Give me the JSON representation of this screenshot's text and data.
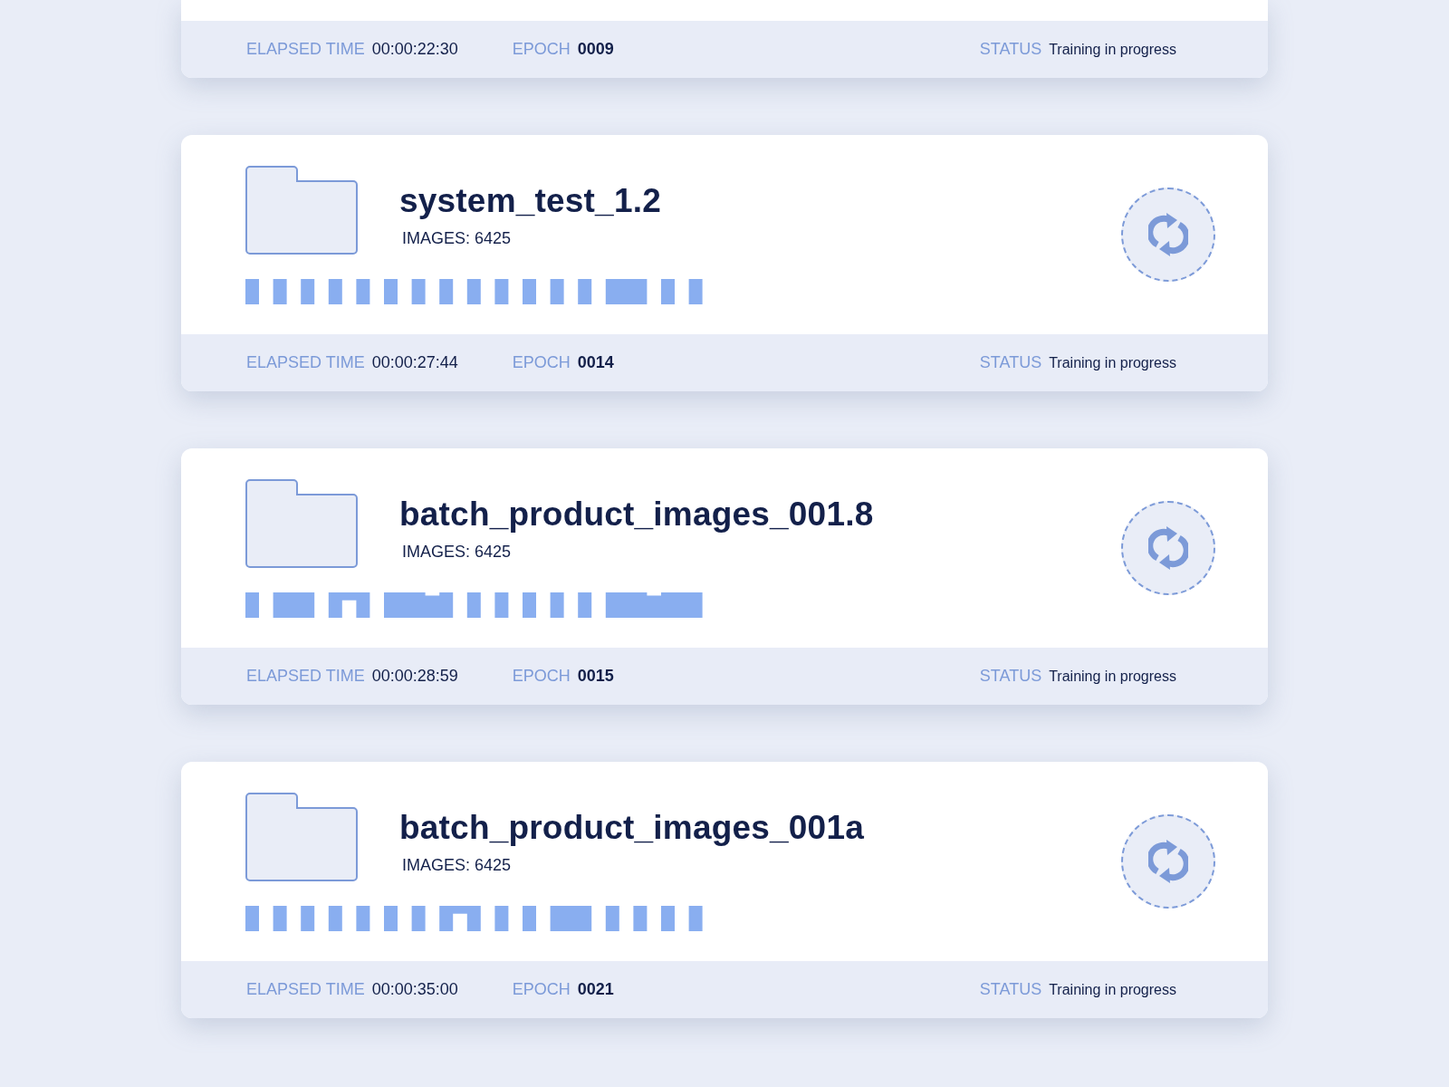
{
  "cards": [
    {
      "elapsed_label": "ELAPSED TIME",
      "elapsed": "00:00:22:30",
      "epoch_label": "EPOCH",
      "epoch": "0009",
      "status_label": "STATUS",
      "status": "Training in progress"
    },
    {
      "name": "system_test_1.2",
      "images": "IMAGES: 6425",
      "segments": [
        {
          "kind": "tick"
        },
        {
          "kind": "tick"
        },
        {
          "kind": "tick"
        },
        {
          "kind": "tick"
        },
        {
          "kind": "tick"
        },
        {
          "kind": "tick"
        },
        {
          "kind": "tick"
        },
        {
          "kind": "tick"
        },
        {
          "kind": "tick"
        },
        {
          "kind": "tick"
        },
        {
          "kind": "tick"
        },
        {
          "kind": "tick"
        },
        {
          "kind": "tick"
        },
        {
          "kind": "wide"
        },
        {
          "kind": "tick"
        },
        {
          "kind": "tick"
        }
      ],
      "elapsed_label": "ELAPSED TIME",
      "elapsed": "00:00:27:44",
      "epoch_label": "EPOCH",
      "epoch": "0014",
      "status_label": "STATUS",
      "status": "Training in progress"
    },
    {
      "name": "batch_product_images_001.8",
      "images": "IMAGES: 6425",
      "segments": [
        {
          "kind": "tick"
        },
        {
          "kind": "wide"
        },
        {
          "kind": "arch"
        },
        {
          "kind": "step"
        },
        {
          "kind": "tick"
        },
        {
          "kind": "tick"
        },
        {
          "kind": "tick"
        },
        {
          "kind": "tick"
        },
        {
          "kind": "tick"
        },
        {
          "kind": "long"
        }
      ],
      "elapsed_label": "ELAPSED TIME",
      "elapsed": "00:00:28:59",
      "epoch_label": "EPOCH",
      "epoch": "0015",
      "status_label": "STATUS",
      "status": "Training in progress"
    },
    {
      "name": "batch_product_images_001a",
      "images": "IMAGES: 6425",
      "segments": [
        {
          "kind": "tick"
        },
        {
          "kind": "tick"
        },
        {
          "kind": "tick"
        },
        {
          "kind": "tick"
        },
        {
          "kind": "tick"
        },
        {
          "kind": "tick"
        },
        {
          "kind": "tick"
        },
        {
          "kind": "arch"
        },
        {
          "kind": "tick"
        },
        {
          "kind": "tick"
        },
        {
          "kind": "wide"
        },
        {
          "kind": "tick"
        },
        {
          "kind": "tick"
        },
        {
          "kind": "tick"
        },
        {
          "kind": "tick"
        }
      ],
      "elapsed_label": "ELAPSED TIME",
      "elapsed": "00:00:35:00",
      "epoch_label": "EPOCH",
      "epoch": "0021",
      "status_label": "STATUS",
      "status": "Training in progress"
    }
  ]
}
